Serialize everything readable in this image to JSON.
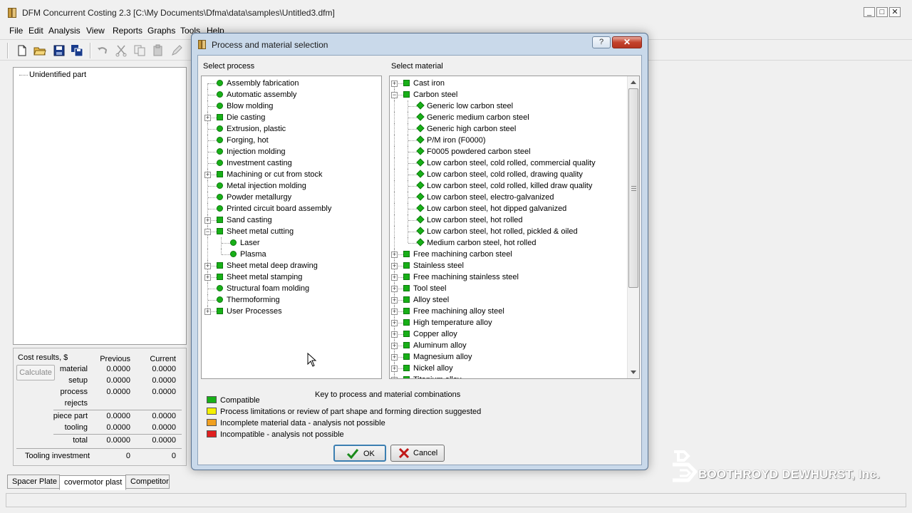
{
  "app": {
    "title": "DFM Concurrent Costing 2.3 [C:\\My Documents\\Dfma\\data\\samples\\Untitled3.dfm]",
    "window_controls": {
      "minimize": "_",
      "maximize": "□",
      "close": "✕"
    }
  },
  "menu": [
    "File",
    "Edit",
    "Analysis",
    "View",
    "Reports",
    "Graphs",
    "Tools",
    "Help"
  ],
  "toolbar": {
    "icons": [
      "new-file-icon",
      "open-folder-icon",
      "save-icon",
      "save-all-icon",
      "undo-icon",
      "cut-icon",
      "copy-icon",
      "paste-icon",
      "edit-icon"
    ]
  },
  "left_tree": {
    "root": "Unidentified part"
  },
  "cost_results": {
    "title": "Cost results, $",
    "calculate_label": "Calculate",
    "col_previous": "Previous",
    "col_current": "Current",
    "rows": [
      {
        "label": "material",
        "previous": "0.0000",
        "current": "0.0000"
      },
      {
        "label": "setup",
        "previous": "0.0000",
        "current": "0.0000"
      },
      {
        "label": "process",
        "previous": "0.0000",
        "current": "0.0000"
      },
      {
        "label": "rejects",
        "previous": "",
        "current": ""
      },
      {
        "label": "piece part",
        "previous": "0.0000",
        "current": "0.0000"
      },
      {
        "label": "tooling",
        "previous": "0.0000",
        "current": "0.0000"
      },
      {
        "label": "total",
        "previous": "0.0000",
        "current": "0.0000"
      },
      {
        "label": "Tooling investment",
        "previous": "0",
        "current": "0"
      }
    ]
  },
  "tabs": [
    "Spacer Plate",
    "covermotor plast",
    "Competitor"
  ],
  "logo": {
    "text": "BOOTHROYD DEWHURST, Inc."
  },
  "dialog": {
    "title": "Process and material selection",
    "help_label": "?",
    "close_label": "✕",
    "process_label": "Select process",
    "material_label": "Select material",
    "processes": [
      {
        "label": "Assembly fabrication",
        "level": 0,
        "node": "circle",
        "expander": ""
      },
      {
        "label": "Automatic assembly",
        "level": 0,
        "node": "circle",
        "expander": ""
      },
      {
        "label": "Blow molding",
        "level": 0,
        "node": "circle",
        "expander": ""
      },
      {
        "label": "Die casting",
        "level": 0,
        "node": "square",
        "expander": "+"
      },
      {
        "label": "Extrusion, plastic",
        "level": 0,
        "node": "circle",
        "expander": ""
      },
      {
        "label": "Forging, hot",
        "level": 0,
        "node": "circle",
        "expander": ""
      },
      {
        "label": "Injection molding",
        "level": 0,
        "node": "circle",
        "expander": ""
      },
      {
        "label": "Investment casting",
        "level": 0,
        "node": "circle",
        "expander": ""
      },
      {
        "label": "Machining or cut from stock",
        "level": 0,
        "node": "square",
        "expander": "+"
      },
      {
        "label": "Metal injection molding",
        "level": 0,
        "node": "circle",
        "expander": ""
      },
      {
        "label": "Powder metallurgy",
        "level": 0,
        "node": "circle",
        "expander": ""
      },
      {
        "label": "Printed circuit board assembly",
        "level": 0,
        "node": "circle",
        "expander": ""
      },
      {
        "label": "Sand casting",
        "level": 0,
        "node": "square",
        "expander": "+"
      },
      {
        "label": "Sheet metal cutting",
        "level": 0,
        "node": "square",
        "expander": "−"
      },
      {
        "label": "Laser",
        "level": 1,
        "node": "circle",
        "expander": ""
      },
      {
        "label": "Plasma",
        "level": 1,
        "node": "circle",
        "expander": ""
      },
      {
        "label": "Sheet metal deep drawing",
        "level": 0,
        "node": "square",
        "expander": "+"
      },
      {
        "label": "Sheet metal stamping",
        "level": 0,
        "node": "square",
        "expander": "+"
      },
      {
        "label": "Structural foam molding",
        "level": 0,
        "node": "circle",
        "expander": ""
      },
      {
        "label": "Thermoforming",
        "level": 0,
        "node": "circle",
        "expander": ""
      },
      {
        "label": "User Processes",
        "level": 0,
        "node": "square",
        "expander": "+"
      }
    ],
    "materials": [
      {
        "label": "Cast iron",
        "level": 0,
        "node": "square",
        "expander": "+"
      },
      {
        "label": "Carbon steel",
        "level": 0,
        "node": "square",
        "expander": "−"
      },
      {
        "label": "Generic low carbon steel",
        "level": 1,
        "node": "diamond",
        "expander": ""
      },
      {
        "label": "Generic medium carbon steel",
        "level": 1,
        "node": "diamond",
        "expander": ""
      },
      {
        "label": "Generic high carbon steel",
        "level": 1,
        "node": "diamond",
        "expander": ""
      },
      {
        "label": "P/M iron (F0000)",
        "level": 1,
        "node": "diamond",
        "expander": ""
      },
      {
        "label": "F0005 powdered carbon steel",
        "level": 1,
        "node": "diamond",
        "expander": ""
      },
      {
        "label": "Low carbon steel, cold rolled, commercial quality",
        "level": 1,
        "node": "diamond",
        "expander": ""
      },
      {
        "label": "Low carbon steel, cold rolled, drawing quality",
        "level": 1,
        "node": "diamond",
        "expander": ""
      },
      {
        "label": "Low carbon steel, cold rolled, killed draw quality",
        "level": 1,
        "node": "diamond",
        "expander": ""
      },
      {
        "label": "Low carbon steel, electro-galvanized",
        "level": 1,
        "node": "diamond",
        "expander": ""
      },
      {
        "label": "Low carbon steel, hot dipped galvanized",
        "level": 1,
        "node": "diamond",
        "expander": ""
      },
      {
        "label": "Low carbon steel, hot rolled",
        "level": 1,
        "node": "diamond",
        "expander": ""
      },
      {
        "label": "Low carbon steel, hot rolled, pickled & oiled",
        "level": 1,
        "node": "diamond",
        "expander": ""
      },
      {
        "label": "Medium carbon steel, hot rolled",
        "level": 1,
        "node": "diamond",
        "expander": ""
      },
      {
        "label": "Free machining carbon steel",
        "level": 0,
        "node": "square",
        "expander": "+"
      },
      {
        "label": "Stainless steel",
        "level": 0,
        "node": "square",
        "expander": "+"
      },
      {
        "label": "Free machining stainless steel",
        "level": 0,
        "node": "square",
        "expander": "+"
      },
      {
        "label": "Tool steel",
        "level": 0,
        "node": "square",
        "expander": "+"
      },
      {
        "label": "Alloy steel",
        "level": 0,
        "node": "square",
        "expander": "+"
      },
      {
        "label": "Free machining alloy steel",
        "level": 0,
        "node": "square",
        "expander": "+"
      },
      {
        "label": "High temperature alloy",
        "level": 0,
        "node": "square",
        "expander": "+"
      },
      {
        "label": "Copper alloy",
        "level": 0,
        "node": "square",
        "expander": "+"
      },
      {
        "label": "Aluminum alloy",
        "level": 0,
        "node": "square",
        "expander": "+"
      },
      {
        "label": "Magnesium alloy",
        "level": 0,
        "node": "square",
        "expander": "+"
      },
      {
        "label": "Nickel alloy",
        "level": 0,
        "node": "square",
        "expander": "+"
      },
      {
        "label": "Titanium alloy",
        "level": 0,
        "node": "square",
        "expander": "+"
      }
    ],
    "key": {
      "title": "Key to process and material combinations",
      "entries": [
        {
          "label": "Compatible",
          "color": "#18b018"
        },
        {
          "label": "Process limitations or review of part shape and forming direction suggested",
          "color": "#f4f000"
        },
        {
          "label": "Incomplete material data - analysis not possible",
          "color": "#f0a020"
        },
        {
          "label": "Incompatible - analysis not possible",
          "color": "#e02020"
        }
      ]
    },
    "ok_label": "OK",
    "cancel_label": "Cancel"
  }
}
